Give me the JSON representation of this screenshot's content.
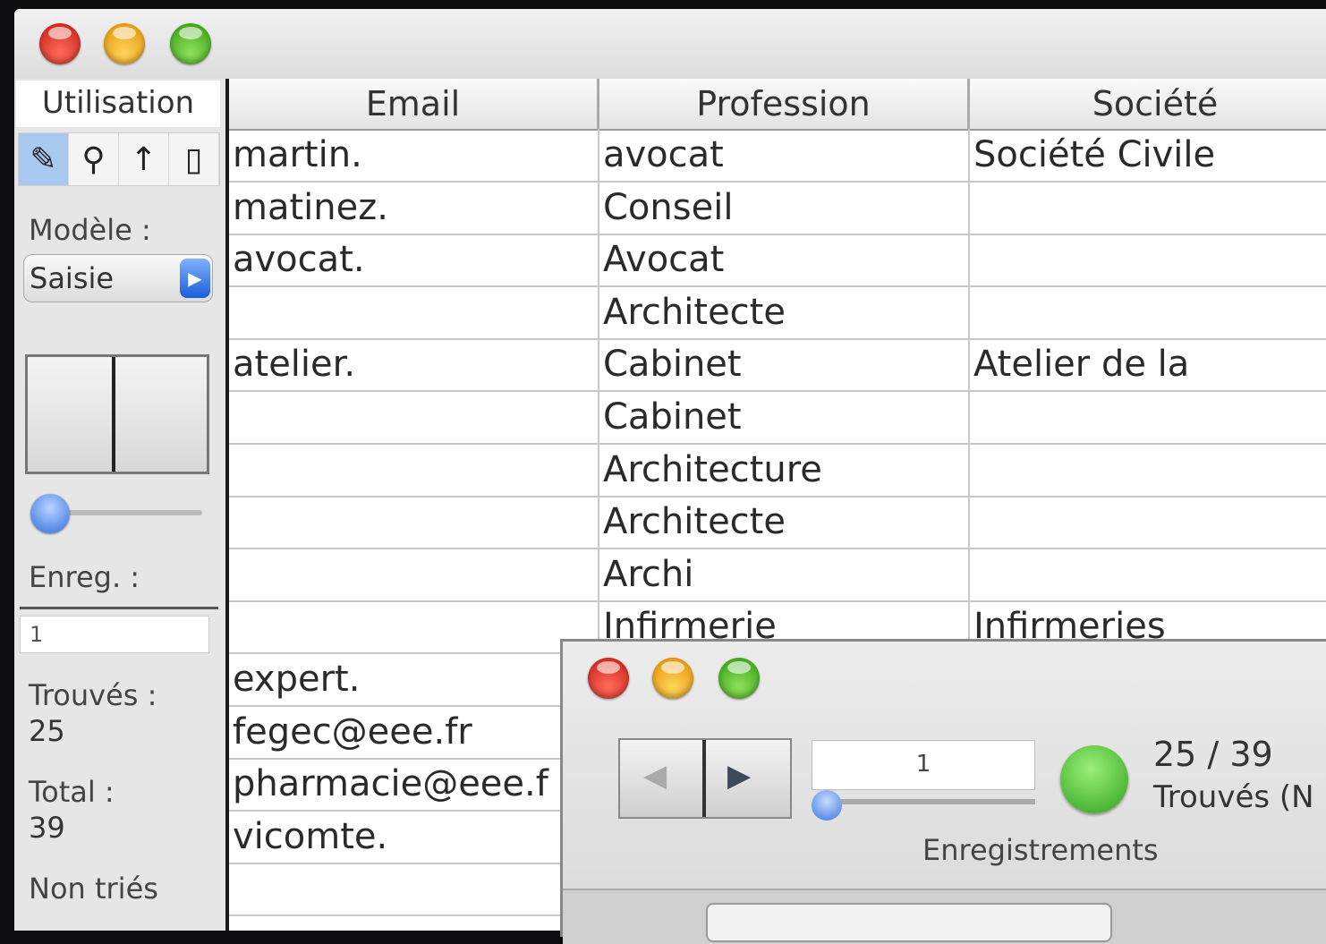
{
  "main_window": {
    "sidebar": {
      "title": "Utilisation",
      "tools": [
        {
          "icon": "pencil-icon",
          "glyph": "✎"
        },
        {
          "icon": "search-icon",
          "glyph": "⚲"
        },
        {
          "icon": "arrow-up-icon",
          "glyph": "↑"
        },
        {
          "icon": "page-icon",
          "glyph": "▯"
        }
      ],
      "model_label": "Modèle :",
      "model_value": "Saisie",
      "record_label": "Enreg. :",
      "record_value": "1",
      "found_label": "Trouvés :",
      "found_value": "25",
      "total_label": "Total :",
      "total_value": "39",
      "sort_label": "Non triés"
    },
    "table": {
      "columns": [
        "Email",
        "Profession",
        "Société"
      ],
      "rows": [
        [
          "martin.",
          "avocat",
          "Société Civile"
        ],
        [
          "matinez.",
          "Conseil",
          ""
        ],
        [
          "avocat.",
          "Avocat",
          ""
        ],
        [
          "",
          "Architecte",
          ""
        ],
        [
          "atelier.",
          "Cabinet",
          "Atelier de la"
        ],
        [
          "",
          "Cabinet",
          ""
        ],
        [
          "",
          "Architecture",
          ""
        ],
        [
          "",
          "Architecte",
          ""
        ],
        [
          "",
          "Archi",
          ""
        ],
        [
          "",
          "Infirmerie",
          "Infirmeries"
        ],
        [
          "expert.",
          "",
          ""
        ],
        [
          "fegec@eee.fr",
          "",
          ""
        ],
        [
          "pharmacie@eee.f",
          "",
          ""
        ],
        [
          "vicomte.",
          "",
          ""
        ],
        [
          "",
          "",
          ""
        ]
      ]
    }
  },
  "second_window": {
    "record_field": "1",
    "count": "25 / 39",
    "found": "Trouvés (N",
    "records_label": "Enregistrements"
  }
}
